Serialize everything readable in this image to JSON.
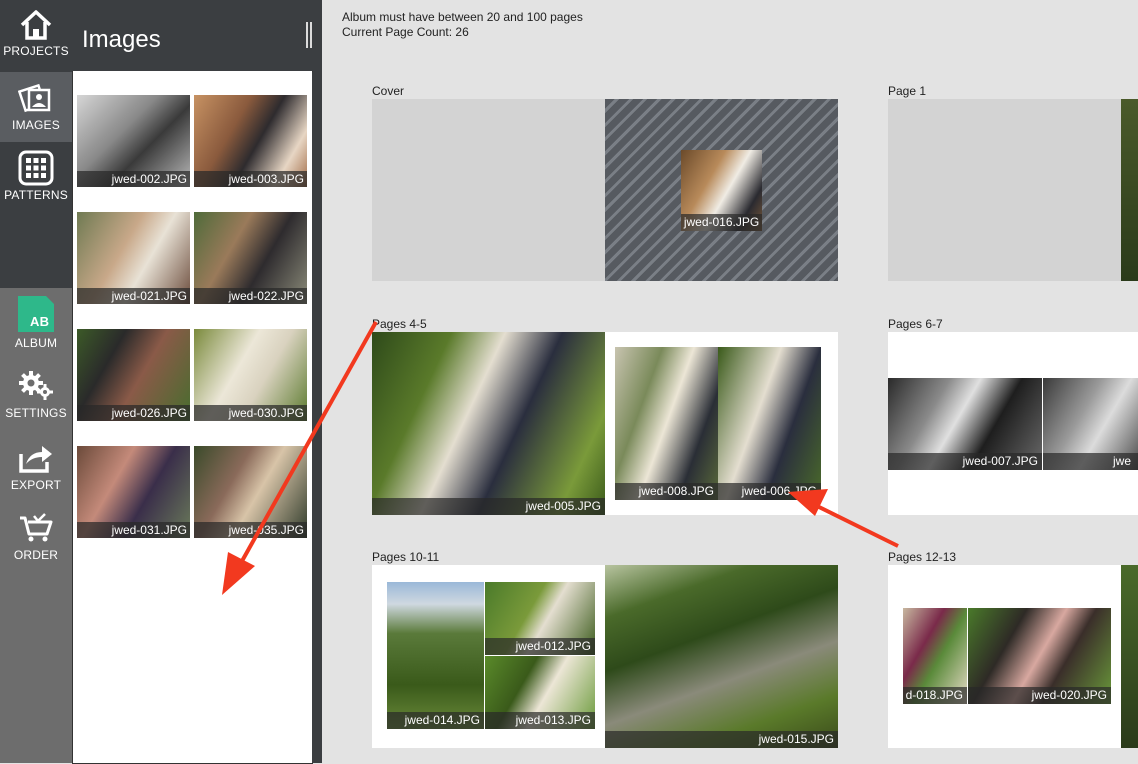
{
  "nav": {
    "items": [
      {
        "label": "PROJECTS",
        "icon": "home-icon"
      },
      {
        "label": "IMAGES",
        "icon": "images-icon"
      },
      {
        "label": "PATTERNS",
        "icon": "patterns-icon"
      },
      {
        "label": "ALBUM",
        "icon": "album-icon",
        "badge": "AB"
      },
      {
        "label": "SETTINGS",
        "icon": "gears-icon"
      },
      {
        "label": "EXPORT",
        "icon": "export-icon"
      },
      {
        "label": "ORDER",
        "icon": "cart-icon"
      }
    ]
  },
  "panel": {
    "title": "Images",
    "thumbs": [
      "jwed-002.JPG",
      "jwed-003.JPG",
      "jwed-021.JPG",
      "jwed-022.JPG",
      "jwed-026.JPG",
      "jwed-030.JPG",
      "jwed-031.JPG",
      "jwed-035.JPG"
    ]
  },
  "main": {
    "info_line1": "Album must have between 20 and 100 pages",
    "info_line2": "Current Page Count: 26",
    "spreads": [
      {
        "label": "Cover",
        "photos": [
          "jwed-016.JPG"
        ]
      },
      {
        "label": "Page 1",
        "photos": []
      },
      {
        "label": "Pages 4-5",
        "photos": [
          "jwed-005.JPG",
          "jwed-008.JPG",
          "jwed-006.JPG"
        ]
      },
      {
        "label": "Pages 6-7",
        "photos": [
          "jwed-007.JPG",
          "jwe"
        ]
      },
      {
        "label": "Pages 10-11",
        "photos": [
          "jwed-012.JPG",
          "jwed-014.JPG",
          "jwed-013.JPG",
          "jwed-015.JPG"
        ]
      },
      {
        "label": "Pages 12-13",
        "photos": [
          "d-018.JPG",
          "jwed-020.JPG"
        ]
      }
    ]
  },
  "colors": {
    "nav_dark": "#3b3e41",
    "nav_mid": "#6d6d6d",
    "album_green": "#2eb88a",
    "arrow_red": "#f2391f"
  }
}
